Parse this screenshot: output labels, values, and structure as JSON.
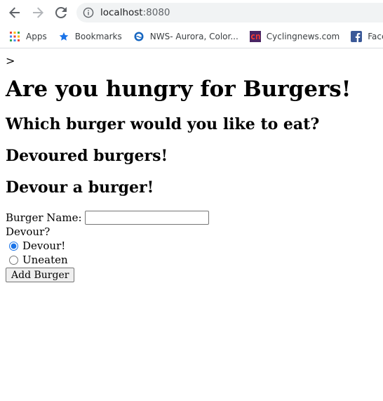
{
  "browser": {
    "url_host": "localhost",
    "url_port": ":8080",
    "bookmarks": [
      {
        "label": "Apps",
        "icon": "apps-grid-icon"
      },
      {
        "label": "Bookmarks",
        "icon": "star-icon"
      },
      {
        "label": "NWS- Aurora, Color...",
        "icon": "nws-icon"
      },
      {
        "label": "Cyclingnews.com",
        "icon": "cyclingnews-icon"
      },
      {
        "label": "Facebook",
        "icon": "facebook-icon"
      }
    ]
  },
  "page": {
    "crumb": ">",
    "title": "Are you hungry for Burgers!",
    "heading_eat": "Which burger would you like to eat?",
    "heading_devoured": "Devoured burgers!",
    "heading_devour": "Devour a burger!"
  },
  "form": {
    "name_label": "Burger Name:",
    "name_value": "",
    "devour_label": "Devour?",
    "option_devour": "Devour!",
    "option_uneaten": "Uneaten",
    "selected": "Devour!",
    "submit_label": "Add Burger"
  },
  "colors": {
    "accent": "#1a73e8"
  }
}
